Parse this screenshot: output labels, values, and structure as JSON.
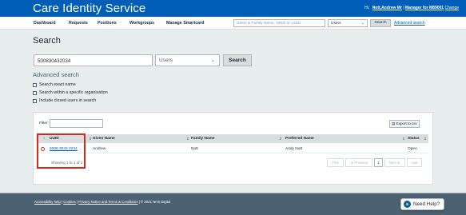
{
  "header": {
    "title": "Care Identity Service",
    "greeting": "Hi,",
    "user_name": "Nott,Andrew Mr",
    "role": "Manager for M89001",
    "change_label": "Change"
  },
  "nav": {
    "items": [
      "Dashboard",
      "Requests",
      "Positions",
      "Workgroups",
      "Manage Smartcard"
    ],
    "search_placeholder": "Given & Family Name, NINO or UUID",
    "select_value": "Users",
    "search_button": "Search",
    "advanced_link": "Advanced search"
  },
  "search": {
    "heading": "Search",
    "uuid_value": "500830432034",
    "type_value": "Users",
    "button_label": "Search"
  },
  "advanced": {
    "heading": "Advanced search",
    "options": [
      "Search exact name",
      "Search within a specific organisation",
      "Include closed users in search"
    ]
  },
  "results": {
    "filter_label": "Filter:",
    "export_label": "Export to csv",
    "columns": [
      "UUID",
      "Given Name",
      "Family Name",
      "Preferred Name",
      "Status"
    ],
    "rows": [
      {
        "uuid": "5008 3043 2034",
        "given_name": "Andrew",
        "family_name": "Nott",
        "preferred_name": "Andy Nott",
        "status": "Open"
      }
    ],
    "showing_text": "Showing 1 to 1 of 1",
    "pagination": {
      "first": "First",
      "previous": "◄ Previous",
      "current_page": "1",
      "next": "Next ►",
      "last": "Last"
    }
  },
  "footer": {
    "links": [
      "Accessibility help",
      "Cookies",
      "Privacy Notice and Terms & Conditions"
    ],
    "copyright": "© 2021 NHS Digital"
  },
  "help_widget": {
    "label": "Need Help?"
  },
  "colors": {
    "brand_blue": "#005eb8",
    "highlight_red": "#d5281b",
    "footer_grey": "#4c6272"
  }
}
